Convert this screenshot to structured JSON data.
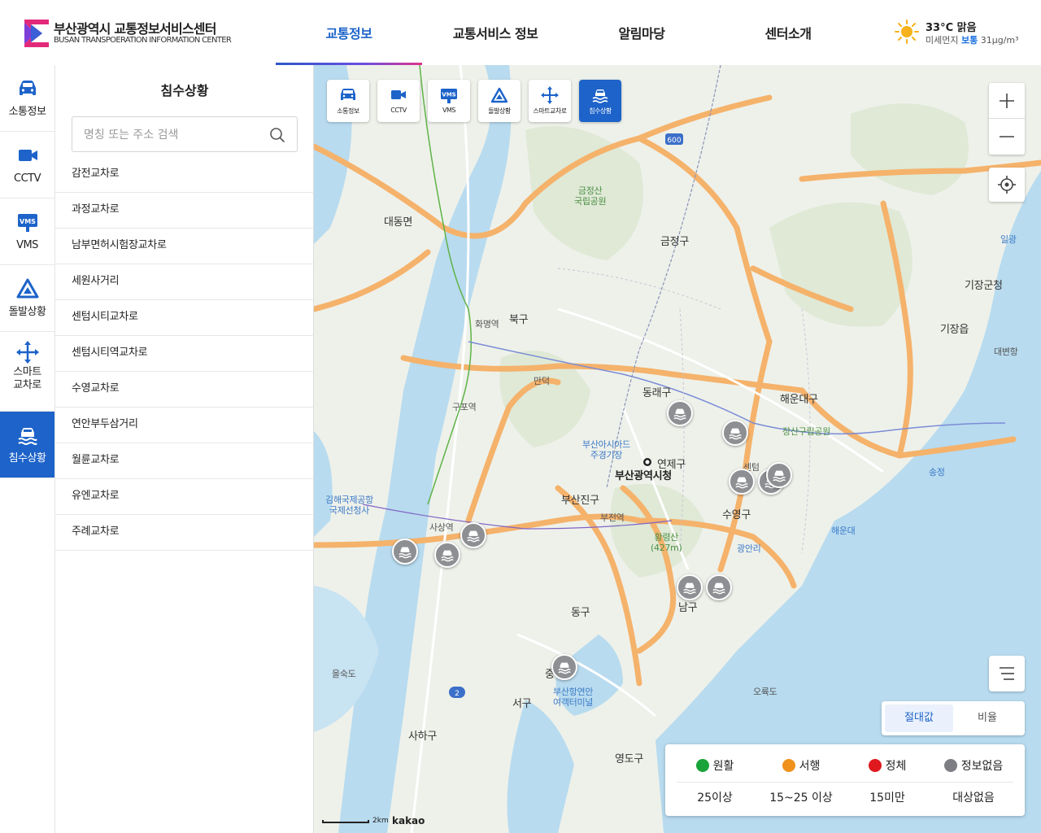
{
  "header": {
    "logo_kr": "부산광역시 교통정보서비스센터",
    "logo_en": "BUSAN TRANSPOERATION INFORMATION CENTER",
    "nav": [
      {
        "label": "교통정보",
        "active": true
      },
      {
        "label": "교통서비스 정보",
        "active": false
      },
      {
        "label": "알림마당",
        "active": false
      },
      {
        "label": "센터소개",
        "active": false
      }
    ],
    "weather": {
      "temp_text": "33°C 맑음",
      "dust_label": "미세먼지",
      "dust_status": "보통",
      "dust_value": "31µg/m³",
      "icon": "sun-icon"
    }
  },
  "rail": {
    "items": [
      {
        "label": "소통정보",
        "icon": "car-icon"
      },
      {
        "label": "CCTV",
        "icon": "video-camera-icon"
      },
      {
        "label": "VMS",
        "icon": "vms-sign-icon"
      },
      {
        "label": "돌발상황",
        "icon": "warning-triangle-icon"
      },
      {
        "label": "스마트\n교차로",
        "label_line1": "스마트",
        "label_line2": "교차로",
        "icon": "arrows-move-icon"
      },
      {
        "label": "침수상황",
        "icon": "flooded-car-icon",
        "active": true
      }
    ]
  },
  "panel": {
    "title": "침수상황",
    "search_placeholder": "명칭 또는 주소 검색",
    "items": [
      "감전교차로",
      "과정교차로",
      "남부면허시험장교차로",
      "세원사거리",
      "센텀시티교차로",
      "센텀시티역교차로",
      "수영교차로",
      "연안부두삼거리",
      "월륜교차로",
      "유엔교차로",
      "주례교차로"
    ]
  },
  "map": {
    "tools": [
      {
        "label": "소통정보",
        "icon": "car-icon"
      },
      {
        "label": "CCTV",
        "icon": "video-camera-icon"
      },
      {
        "label": "VMS",
        "icon": "vms-sign-icon"
      },
      {
        "label": "돌발상황",
        "icon": "warning-triangle-icon"
      },
      {
        "label": "스마트교차로",
        "icon": "arrows-move-icon"
      },
      {
        "label": "침수상황",
        "icon": "flooded-car-icon",
        "active": true
      }
    ],
    "mode_toggle": {
      "absolute": "절대값",
      "ratio": "비율",
      "selected": "절대값"
    },
    "legend": [
      {
        "name": "원활",
        "color": "#1aa33a",
        "value": "25이상"
      },
      {
        "name": "서행",
        "color": "#f0911e",
        "value": "15~25 이상"
      },
      {
        "name": "정체",
        "color": "#e0191e",
        "value": "15미만"
      },
      {
        "name": "정보없음",
        "color": "#7d7e83",
        "value": "대상없음"
      }
    ],
    "scale_text": "2km",
    "attribution": "kakao",
    "labels": {
      "busan_city_hall": "부산광역시청",
      "yeonje": "연제구",
      "dongnae": "동래구",
      "haeundae": "해운대구",
      "geumjeong": "금정구",
      "buk": "북구",
      "busanjin": "부산진구",
      "suyeong": "수영구",
      "nam": "남구",
      "dong": "동구",
      "seo": "서구",
      "saha": "사하구",
      "yeongdo": "영도구",
      "jung": "중구",
      "gijang": "기장군청",
      "gijang_eup": "기장읍",
      "daedong": "대동면",
      "sasang": "사상역",
      "gupo": "구포역",
      "hwamyeong": "화명역",
      "geumjeongsan": "금정산\n국립공원",
      "jangsan": "장산구립공원",
      "hwangnyeongsan": "황령산\n(427m)",
      "asiad": "부산아시아드\n주경기장",
      "haeundae_beach": "해운대",
      "gwangalli": "광안리",
      "gimhae_airport": "김해국제공항\n국제선청사",
      "eulsukdo": "을숙도",
      "songjeong": "송정",
      "oryukdo": "오륙도",
      "ilgwang": "일광",
      "daebyeon": "대변항",
      "centum": "센텀",
      "busanjin_station": "부전역",
      "manduk": "만덕",
      "busan_port": "부산항연안\n여객터미널"
    },
    "flood_markers_count": 11
  }
}
